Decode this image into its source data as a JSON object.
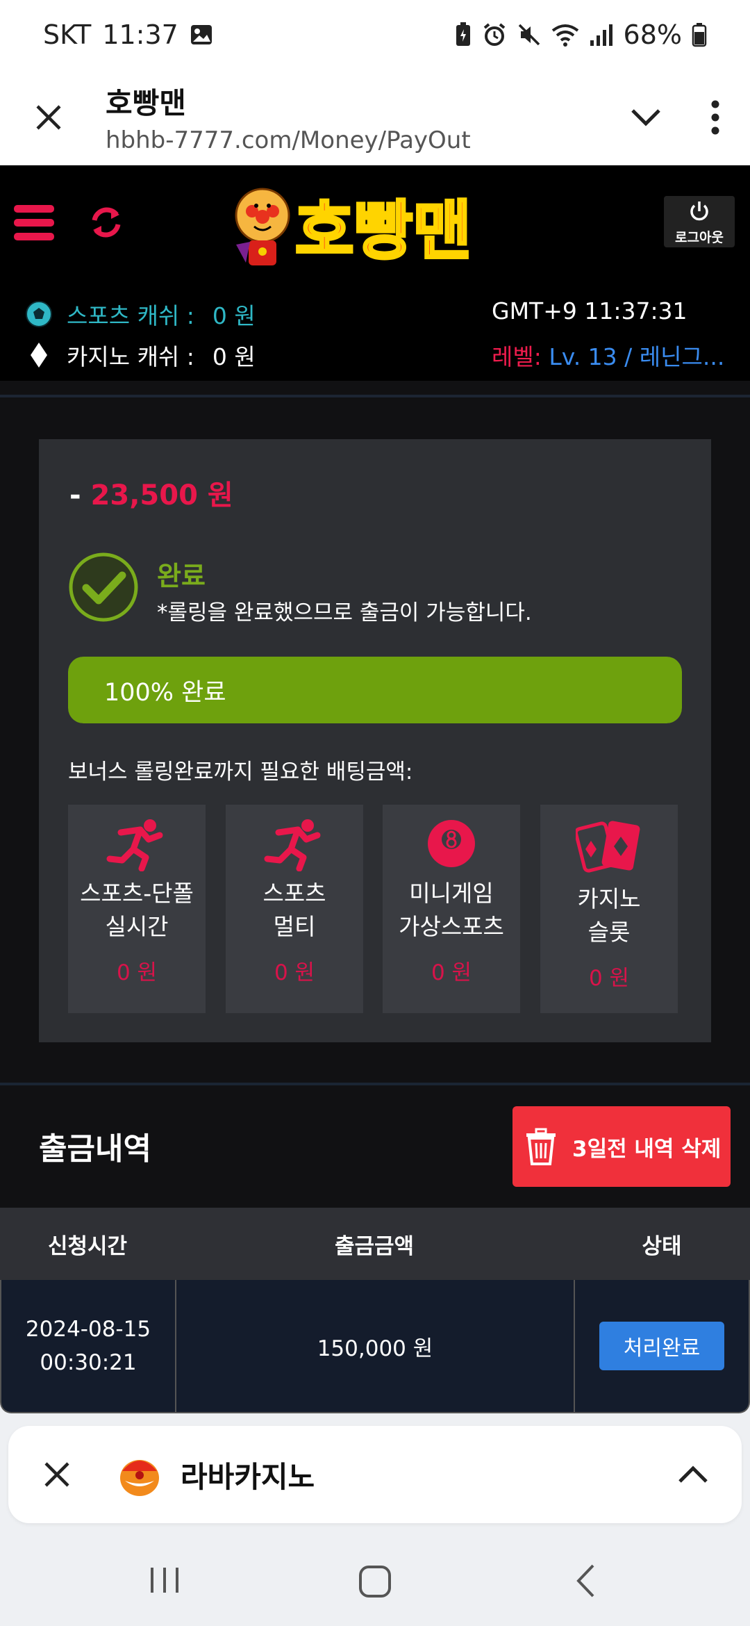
{
  "status_bar": {
    "carrier": "SKT",
    "time": "11:37",
    "battery": "68%"
  },
  "browser": {
    "site_title": "호빵맨",
    "url": "hbhb-7777.com/Money/PayOut"
  },
  "header": {
    "logo_text": "호빵맨",
    "logout_label": "로그아웃",
    "sports_cash_label": "스포츠 캐쉬 :",
    "sports_cash_value": "0 원",
    "casino_cash_label": "카지노 캐쉬 :",
    "casino_cash_value": "0 원",
    "gmt_time": "GMT+9 11:37:31",
    "level_label": "레벨:",
    "level_value": "Lv. 13 / 레닌그..."
  },
  "payout_card": {
    "amount_prefix": "-",
    "amount": "23,500 원",
    "status_title": "완료",
    "status_desc": "*롤링을 완료했으므로 출금이 가능합니다.",
    "progress_label": "100% 완료",
    "progress_percent": 100,
    "required_text": "보너스 롤링완료까지 필요한 배팅금액:",
    "tiles": [
      {
        "line1": "스포츠-단폴",
        "line2": "실시간",
        "value": "0 원"
      },
      {
        "line1": "스포츠",
        "line2": "멀티",
        "value": "0 원"
      },
      {
        "line1": "미니게임",
        "line2": "가상스포츠",
        "value": "0 원"
      },
      {
        "line1": "카지노",
        "line2": "슬롯",
        "value": "0 원"
      }
    ]
  },
  "history": {
    "title": "출금내역",
    "delete_button": "3일전 내역 삭제",
    "columns": [
      "신청시간",
      "출금금액",
      "상태"
    ],
    "rows": [
      {
        "date": "2024-08-15",
        "time": "00:30:21",
        "amount": "150,000 원",
        "status": "처리완료"
      }
    ]
  },
  "tab_bar": {
    "tab_name": "라바카지노"
  },
  "colors": {
    "accent_red": "#e8174b",
    "accent_green": "#6ea10d",
    "accent_blue": "#2f7fe0",
    "cyan": "#2fb8c6"
  }
}
